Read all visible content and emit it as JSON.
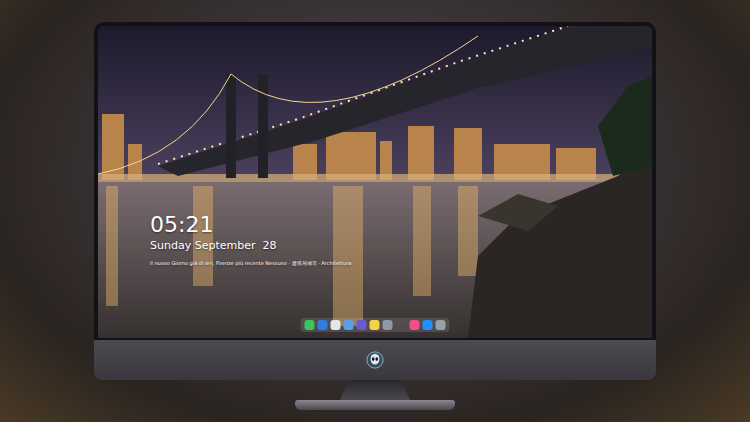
{
  "lock_screen": {
    "time": "05:21",
    "date": "Sunday September  28",
    "quote": "Il nuovo Giorno già di ieri, Firenze più recente Nessuno · 建筑与城市 · Architettura"
  },
  "dock": {
    "apps": [
      {
        "color": "#3bc45a"
      },
      {
        "color": "#2f7de0"
      },
      {
        "color": "#e6e6e6"
      },
      {
        "color": "#5aa0e6"
      },
      {
        "color": "#6a5acd"
      },
      {
        "color": "#f5d547"
      },
      {
        "color": "#8e9aa6"
      },
      {
        "color": "#f0508a"
      },
      {
        "color": "#1e90ff"
      },
      {
        "color": "#9aa0a6"
      }
    ]
  }
}
